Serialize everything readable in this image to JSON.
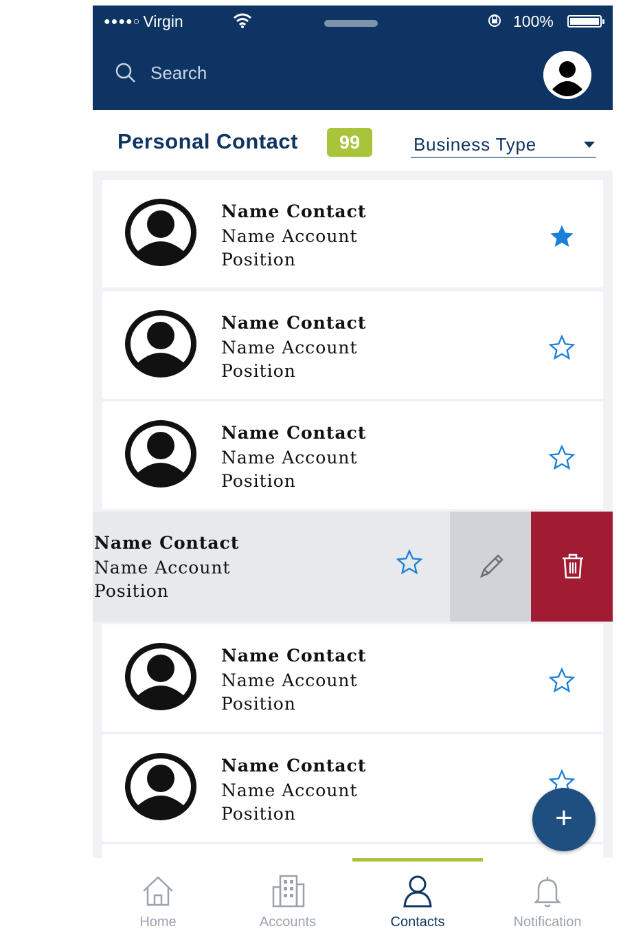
{
  "status_bar": {
    "carrier": "Virgin",
    "battery": "100%"
  },
  "search": {
    "placeholder": "Search"
  },
  "section": {
    "title": "Personal Contact",
    "count": "99",
    "filter_label": "Business Type"
  },
  "contacts": [
    {
      "name": "Name Contact",
      "account": "Name Account",
      "position": "Position",
      "favorite": true
    },
    {
      "name": "Name Contact",
      "account": "Name Account",
      "position": "Position",
      "favorite": false
    },
    {
      "name": "Name Contact",
      "account": "Name Account",
      "position": "Position",
      "favorite": false
    },
    {
      "name": "Name Contact",
      "account": "Name Account",
      "position": "Position",
      "favorite": false,
      "swiped": true
    },
    {
      "name": "Name Contact",
      "account": "Name Account",
      "position": "Position",
      "favorite": false
    },
    {
      "name": "Name Contact",
      "account": "Name Account",
      "position": "Position",
      "favorite": false
    }
  ],
  "swipe_actions": {
    "edit_icon": "pencil-icon",
    "delete_icon": "trash-icon",
    "delete_color": "#a11b32"
  },
  "fab": {
    "label": "+"
  },
  "bottom_nav": [
    {
      "label": "Home",
      "icon": "home-icon",
      "active": false
    },
    {
      "label": "Accounts",
      "icon": "building-icon",
      "active": false
    },
    {
      "label": "Contacts",
      "icon": "person-icon",
      "active": true
    },
    {
      "label": "Notification",
      "icon": "bell-icon",
      "active": false
    }
  ],
  "colors": {
    "header": "#0e3463",
    "accent": "#a8c43a",
    "star": "#1a7fd8",
    "primary_text": "#0f3563"
  }
}
